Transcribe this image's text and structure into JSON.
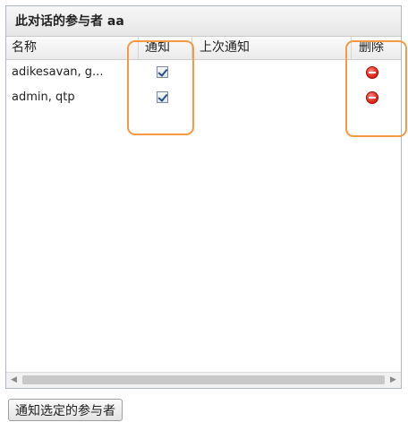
{
  "panel": {
    "title": "此对话的参与者 aa"
  },
  "columns": {
    "name": "名称",
    "notify": "通知",
    "last_notified": "上次通知",
    "delete": "删除"
  },
  "rows": [
    {
      "name": "adikesavan, g...",
      "notify": true,
      "last_notified": ""
    },
    {
      "name": "admin, qtp",
      "notify": true,
      "last_notified": ""
    }
  ],
  "icons": {
    "notify_checkbox": "checkbox-checked-icon",
    "delete": "delete-minus-icon",
    "scroll_left": "arrow-left-icon",
    "scroll_right": "arrow-right-icon"
  },
  "footer": {
    "notify_selected_label": "通知选定的参与者"
  },
  "colors": {
    "highlight": "#f39a43",
    "delete_red": "#e0281c"
  }
}
